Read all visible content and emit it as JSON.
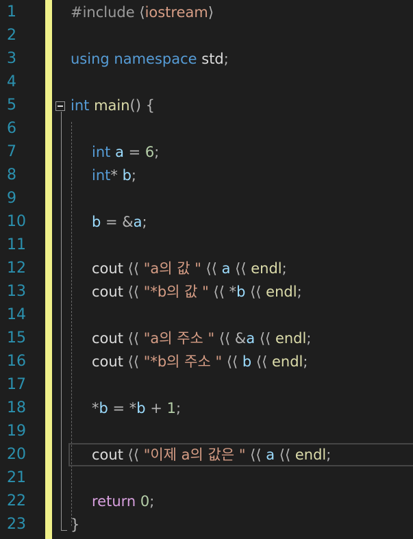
{
  "editor": {
    "lines": [
      {
        "n": "1",
        "indent": 0,
        "tokens": [
          [
            "pre",
            "#include "
          ],
          [
            "p",
            "⟨"
          ],
          [
            "str",
            "iostream"
          ],
          [
            "p",
            "⟩"
          ]
        ]
      },
      {
        "n": "2",
        "indent": 0,
        "tokens": []
      },
      {
        "n": "3",
        "indent": 0,
        "tokens": [
          [
            "kw",
            "using namespace "
          ],
          [
            "id",
            "std"
          ],
          [
            "p",
            ";"
          ]
        ]
      },
      {
        "n": "4",
        "indent": 0,
        "tokens": []
      },
      {
        "n": "5",
        "indent": 0,
        "tokens": [
          [
            "kw",
            "int "
          ],
          [
            "fn",
            "main"
          ],
          [
            "p",
            "() {"
          ]
        ]
      },
      {
        "n": "6",
        "indent": 1,
        "tokens": []
      },
      {
        "n": "7",
        "indent": 1,
        "tokens": [
          [
            "kw",
            "int "
          ],
          [
            "var",
            "a"
          ],
          [
            "p",
            " = "
          ],
          [
            "num",
            "6"
          ],
          [
            "p",
            ";"
          ]
        ]
      },
      {
        "n": "8",
        "indent": 1,
        "tokens": [
          [
            "kw",
            "int"
          ],
          [
            "p",
            "* "
          ],
          [
            "var",
            "b"
          ],
          [
            "p",
            ";"
          ]
        ]
      },
      {
        "n": "9",
        "indent": 1,
        "tokens": []
      },
      {
        "n": "10",
        "indent": 1,
        "tokens": [
          [
            "var",
            "b"
          ],
          [
            "p",
            " = &"
          ],
          [
            "var",
            "a"
          ],
          [
            "p",
            ";"
          ]
        ]
      },
      {
        "n": "11",
        "indent": 1,
        "tokens": []
      },
      {
        "n": "12",
        "indent": 1,
        "tokens": [
          [
            "id",
            "cout "
          ],
          [
            "p",
            "⟨⟨ "
          ],
          [
            "str",
            "\"a의 값 \""
          ],
          [
            "p",
            " ⟨⟨ "
          ],
          [
            "var",
            "a"
          ],
          [
            "p",
            " ⟨⟨ "
          ],
          [
            "fn",
            "endl"
          ],
          [
            "p",
            ";"
          ]
        ]
      },
      {
        "n": "13",
        "indent": 1,
        "tokens": [
          [
            "id",
            "cout "
          ],
          [
            "p",
            "⟨⟨ "
          ],
          [
            "str",
            "\"*b의 값 \""
          ],
          [
            "p",
            " ⟨⟨ *"
          ],
          [
            "var",
            "b"
          ],
          [
            "p",
            " ⟨⟨ "
          ],
          [
            "fn",
            "endl"
          ],
          [
            "p",
            ";"
          ]
        ]
      },
      {
        "n": "14",
        "indent": 1,
        "tokens": []
      },
      {
        "n": "15",
        "indent": 1,
        "tokens": [
          [
            "id",
            "cout "
          ],
          [
            "p",
            "⟨⟨ "
          ],
          [
            "str",
            "\"a의 주소 \""
          ],
          [
            "p",
            " ⟨⟨ &"
          ],
          [
            "var",
            "a"
          ],
          [
            "p",
            " ⟨⟨ "
          ],
          [
            "fn",
            "endl"
          ],
          [
            "p",
            ";"
          ]
        ]
      },
      {
        "n": "16",
        "indent": 1,
        "tokens": [
          [
            "id",
            "cout "
          ],
          [
            "p",
            "⟨⟨ "
          ],
          [
            "str",
            "\"*b의 주소 \""
          ],
          [
            "p",
            " ⟨⟨ "
          ],
          [
            "var",
            "b"
          ],
          [
            "p",
            " ⟨⟨ "
          ],
          [
            "fn",
            "endl"
          ],
          [
            "p",
            ";"
          ]
        ]
      },
      {
        "n": "17",
        "indent": 1,
        "tokens": []
      },
      {
        "n": "18",
        "indent": 1,
        "tokens": [
          [
            "p",
            "*"
          ],
          [
            "var",
            "b"
          ],
          [
            "p",
            " = *"
          ],
          [
            "var",
            "b"
          ],
          [
            "p",
            " + "
          ],
          [
            "num",
            "1"
          ],
          [
            "p",
            ";"
          ]
        ]
      },
      {
        "n": "19",
        "indent": 1,
        "tokens": []
      },
      {
        "n": "20",
        "indent": 1,
        "tokens": [
          [
            "id",
            "cout "
          ],
          [
            "p",
            "⟨⟨ "
          ],
          [
            "str",
            "\"이제 a의 값은 \""
          ],
          [
            "p",
            " ⟨⟨ "
          ],
          [
            "var",
            "a"
          ],
          [
            "p",
            " ⟨⟨ "
          ],
          [
            "fn",
            "endl"
          ],
          [
            "p",
            ";"
          ]
        ]
      },
      {
        "n": "21",
        "indent": 1,
        "tokens": []
      },
      {
        "n": "22",
        "indent": 1,
        "tokens": [
          [
            "ctl",
            "return "
          ],
          [
            "num",
            "0"
          ],
          [
            "p",
            ";"
          ]
        ]
      },
      {
        "n": "23",
        "indent": 0,
        "tokens": [
          [
            "p",
            "}"
          ]
        ]
      }
    ]
  }
}
